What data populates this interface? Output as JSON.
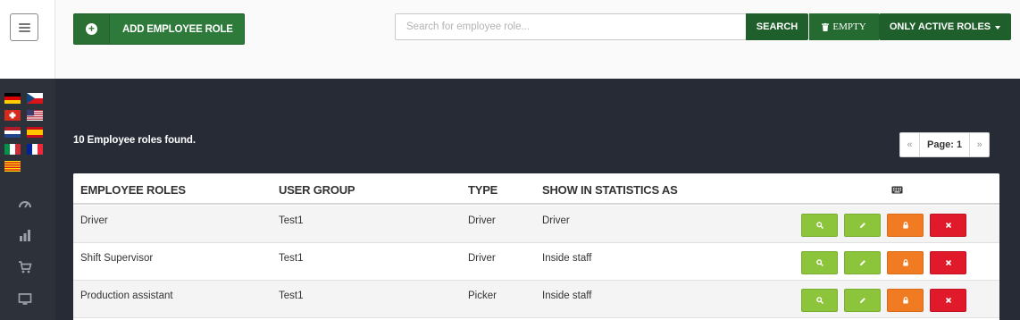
{
  "header": {
    "add_button_label": "ADD EMPLOYEE ROLE",
    "search_placeholder": "Search for employee role...",
    "search_value": "",
    "search_button_label": "SEARCH",
    "empty_button_label": "EMPTY",
    "filter_button_label": "ONLY ACTIVE ROLES"
  },
  "sidebar": {
    "languages": [
      "german",
      "czech",
      "swiss",
      "american",
      "dutch",
      "spanish",
      "italian",
      "french",
      "catalan"
    ],
    "nav_icons": [
      "dashboard-icon",
      "statistics-icon",
      "cart-icon",
      "monitor-icon"
    ]
  },
  "results": {
    "count_text": "10 Employee roles found.",
    "pager": {
      "prev": "«",
      "page_label": "Page: 1",
      "next": "»"
    }
  },
  "table": {
    "columns": [
      "EMPLOYEE ROLES",
      "USER GROUP",
      "TYPE",
      "SHOW IN STATISTICS AS"
    ],
    "rows": [
      {
        "role": "Driver",
        "group": "Test1",
        "type": "Driver",
        "stat": "Driver"
      },
      {
        "role": "Shift Supervisor",
        "group": "Test1",
        "type": "Driver",
        "stat": "Inside staff"
      },
      {
        "role": "Production assistant",
        "group": "Test1",
        "type": "Picker",
        "stat": "Inside staff"
      }
    ]
  },
  "colors": {
    "primary_green": "#2e7a3a",
    "dark_green": "#1f5f2b",
    "view_green": "#8cc43c",
    "lock_orange": "#f07b22",
    "delete_red": "#e01a2a",
    "content_bg": "#262b36"
  }
}
